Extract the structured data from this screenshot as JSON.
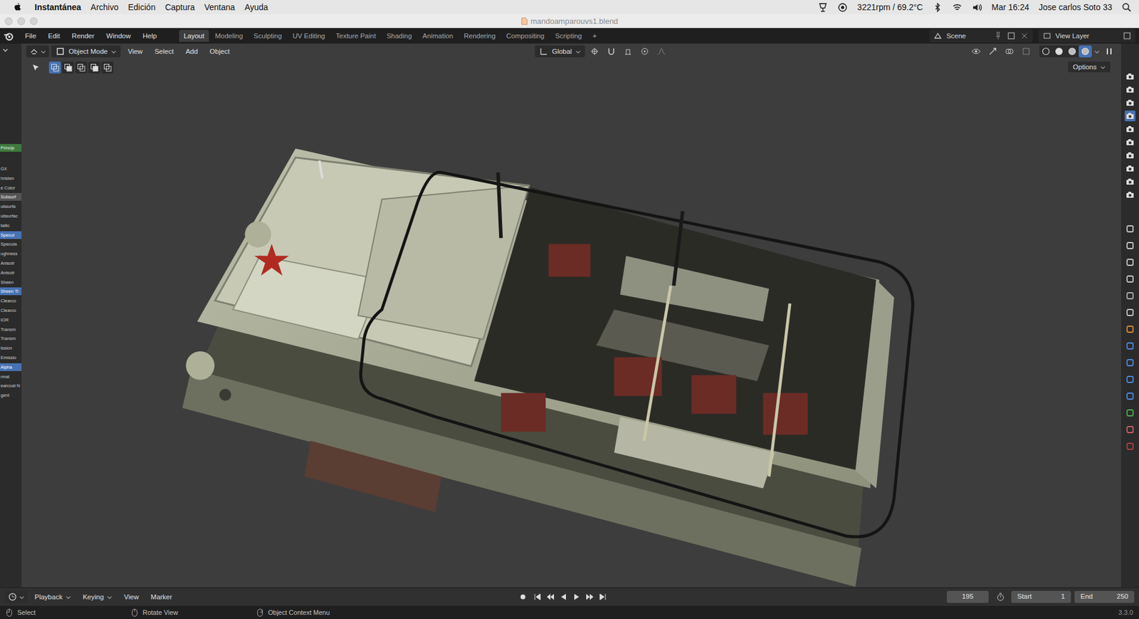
{
  "menubar": {
    "app": "Instantánea",
    "menus": [
      "Archivo",
      "Edición",
      "Captura",
      "Ventana",
      "Ayuda"
    ],
    "status": "3221rpm / 69.2°C",
    "clock": "Mar 16:24",
    "user": "Jose carlos Soto 33"
  },
  "window": {
    "title": "mandoamparouvs1.blend"
  },
  "blender_menus": [
    "File",
    "Edit",
    "Render",
    "Window",
    "Help"
  ],
  "workspaces": [
    {
      "label": "Layout",
      "selected": true
    },
    {
      "label": "Modeling",
      "selected": false
    },
    {
      "label": "Sculpting",
      "selected": false
    },
    {
      "label": "UV Editing",
      "selected": false
    },
    {
      "label": "Texture Paint",
      "selected": false
    },
    {
      "label": "Shading",
      "selected": false
    },
    {
      "label": "Animation",
      "selected": false
    },
    {
      "label": "Rendering",
      "selected": false
    },
    {
      "label": "Compositing",
      "selected": false
    },
    {
      "label": "Scripting",
      "selected": false
    }
  ],
  "add_tab": "+",
  "scene": "Scene",
  "view_layer": "View Layer",
  "viewport_header": {
    "mode": "Object Mode",
    "menus": [
      "View",
      "Select",
      "Add",
      "Object"
    ],
    "orientation": "Global",
    "options": "Options"
  },
  "select_modes": [
    {
      "selected": true
    },
    {
      "selected": false
    },
    {
      "selected": false
    },
    {
      "selected": false
    },
    {
      "selected": false
    }
  ],
  "shading_modes": [
    {
      "selected": false
    },
    {
      "selected": false
    },
    {
      "selected": false
    },
    {
      "selected": true
    }
  ],
  "side_labels": [
    {
      "text": "Princip",
      "kind": "node"
    },
    {
      "text": "GX",
      "kind": "label"
    },
    {
      "text": "hristen",
      "kind": "label"
    },
    {
      "text": "e Color",
      "kind": "label"
    },
    {
      "text": "Subsurf",
      "kind": "field"
    },
    {
      "text": "ubsurfa",
      "kind": "label"
    },
    {
      "text": "ubsurfac",
      "kind": "label"
    },
    {
      "text": "tallic",
      "kind": "label"
    },
    {
      "text": "Specul",
      "kind": "slider"
    },
    {
      "text": "Specula",
      "kind": "label"
    },
    {
      "text": "ughness",
      "kind": "label"
    },
    {
      "text": "Anisotr",
      "kind": "label"
    },
    {
      "text": "Anisotr",
      "kind": "label"
    },
    {
      "text": "Sheen",
      "kind": "label"
    },
    {
      "text": "Sheen Ti",
      "kind": "slider"
    },
    {
      "text": "Clearco",
      "kind": "label"
    },
    {
      "text": "Clearco",
      "kind": "label"
    },
    {
      "text": "IOR",
      "kind": "label"
    },
    {
      "text": "Transm",
      "kind": "label"
    },
    {
      "text": "Transm",
      "kind": "label"
    },
    {
      "text": "ission",
      "kind": "label"
    },
    {
      "text": "Emissio",
      "kind": "label"
    },
    {
      "text": "Alpha",
      "kind": "slider"
    },
    {
      "text": "rmal",
      "kind": "label"
    },
    {
      "text": "earcoat N",
      "kind": "label"
    },
    {
      "text": "gent",
      "kind": "label"
    }
  ],
  "render_toggles": [
    {
      "selected": false
    },
    {
      "selected": false
    },
    {
      "selected": false
    },
    {
      "selected": true
    },
    {
      "selected": false
    },
    {
      "selected": false
    },
    {
      "selected": false
    },
    {
      "selected": false
    },
    {
      "selected": false
    },
    {
      "selected": false
    }
  ],
  "timeline": {
    "menus": [
      "Playback",
      "Keying",
      "View",
      "Marker"
    ],
    "frame": "195",
    "start_label": "Start",
    "start": "1",
    "end_label": "End",
    "end": "250"
  },
  "status_bar": {
    "items": [
      "Select",
      "Rotate View",
      "Object Context Menu"
    ],
    "version": "3.3.0"
  }
}
